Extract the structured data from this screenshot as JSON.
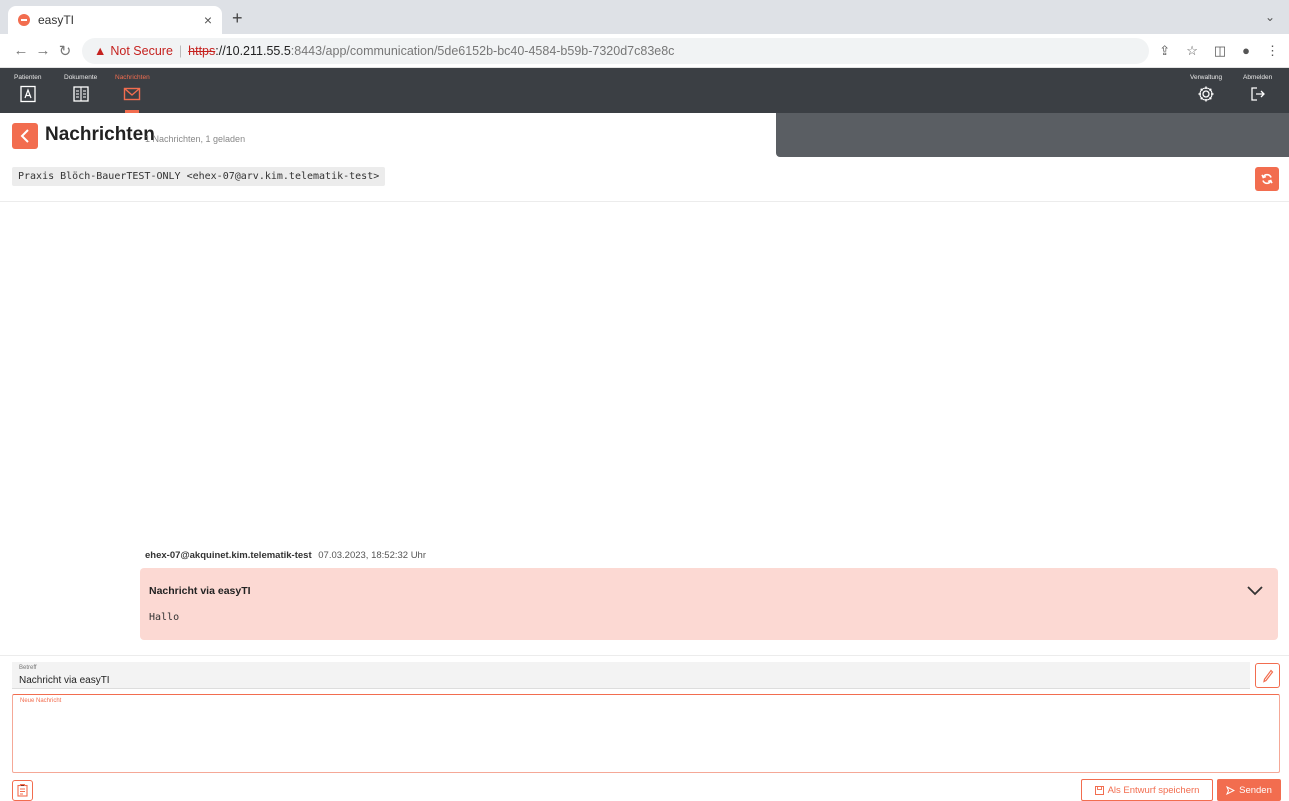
{
  "browser": {
    "tab_title": "easyTI",
    "tab_close": "×",
    "new_tab": "+",
    "tab_menu": "⌄",
    "not_secure": "Not Secure",
    "url_scheme": "https",
    "url_host": "://10.211.55.5",
    "url_path": ":8443/app/communication/5de6152b-bc40-4584-b59b-7320d7c83e8c"
  },
  "appnav": {
    "items": [
      {
        "label": "Patienten",
        "icon": "patient-card-icon"
      },
      {
        "label": "Dokumente",
        "icon": "documents-icon"
      },
      {
        "label": "Nachrichten",
        "icon": "mail-icon",
        "active": true
      }
    ],
    "right": [
      {
        "label": "Verwaltung",
        "icon": "gear-icon"
      },
      {
        "label": "Abmelden",
        "icon": "logout-icon"
      }
    ],
    "accent": "#f26d4f"
  },
  "header": {
    "title": "Nachrichten",
    "subtitle": "1 Nachrichten, 1 geladen"
  },
  "conversation": {
    "recipient": "Praxis Blöch-BauerTEST-ONLY <ehex-07@arv.kim.telematik-test>"
  },
  "messages": [
    {
      "sender": "ehex-07@akquinet.kim.telematik-test",
      "timestamp": "07.03.2023, 18:52:32 Uhr",
      "subject": "Nachricht via easyTI",
      "body": "Hallo"
    }
  ],
  "compose": {
    "subject_label": "Betreff",
    "subject_value": "Nachricht via easyTI",
    "body_label": "Neue Nachricht",
    "draft_label": "Als Entwurf speichern",
    "send_label": "Senden"
  }
}
